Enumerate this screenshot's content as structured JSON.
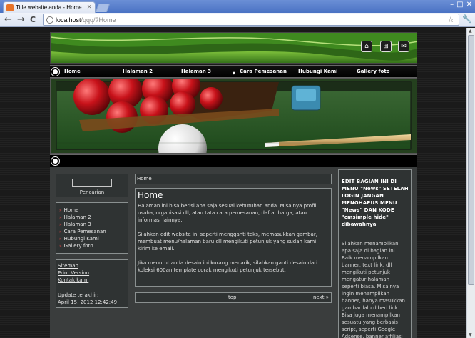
{
  "browser": {
    "tab_title": "Title website anda - Home",
    "tab_close": "×",
    "address_host": "localhost",
    "address_path": "/qqq/?Home",
    "back": "←",
    "forward": "→",
    "reload": "C",
    "star": "☆",
    "wrench": "🔧",
    "win_min": "–",
    "win_max": "□",
    "win_close": "✕"
  },
  "header": {
    "icons": [
      "home-icon",
      "sitemap-icon",
      "mail-icon"
    ]
  },
  "menu": {
    "items": [
      "Home",
      "Halaman 2",
      "Halaman 3",
      "Cara Pemesanan",
      "Hubungi Kami",
      "Gallery foto"
    ]
  },
  "sidebar": {
    "search_label": "Pencarian",
    "items": [
      "Home",
      "Halaman 2",
      "Halaman 3",
      "Cara Pemesanan",
      "Hubungi Kami",
      "Gallery foto"
    ],
    "links": [
      "Sitemap",
      "Print Version",
      "Kontak kami"
    ],
    "updated_label": "Update terakhir:",
    "updated_value": "April 15, 2012 12:42:49"
  },
  "main": {
    "breadcrumb": "Home",
    "title": "Home",
    "paragraphs": [
      "Halaman ini bisa berisi apa saja sesuai kebutuhan anda. Misalnya profil usaha, organisasi dll, atau tata cara pemesanan, daftar harga, atau informasi lainnya.",
      "Silahkan edit website ini seperti mengganti teks, memasukkan gambar, membuat menu/halaman baru dll mengikuti petunjuk yang sudah kami kirim ke email.",
      "Jika menurut anda desain ini kurang menarik, silahkan ganti desain dari koleksi 600an template corak mengikuti petunjuk tersebut."
    ],
    "pager_top": "top",
    "pager_next": "next »"
  },
  "right": {
    "heading": "EDIT BAGIAN INI DI MENU \"News\" SETELAH LOGIN JANGAN MENGHAPUS MENU \"News\" DAN KODE \"cmsimple hide\" dibawahnya",
    "text": "Silahkan menampilkan apa saja di bagian ini. Baik menampilkan banner, text link, dll mengikuti petunjuk mengatur halaman seperti biasa. Misalnya ingin menampilkan banner, hanya masukkan gambar lalu diberi link. Bisa juga menampilkan sesuatu yang berbasis script, seperti Google Adsense, banner affiliasi"
  }
}
